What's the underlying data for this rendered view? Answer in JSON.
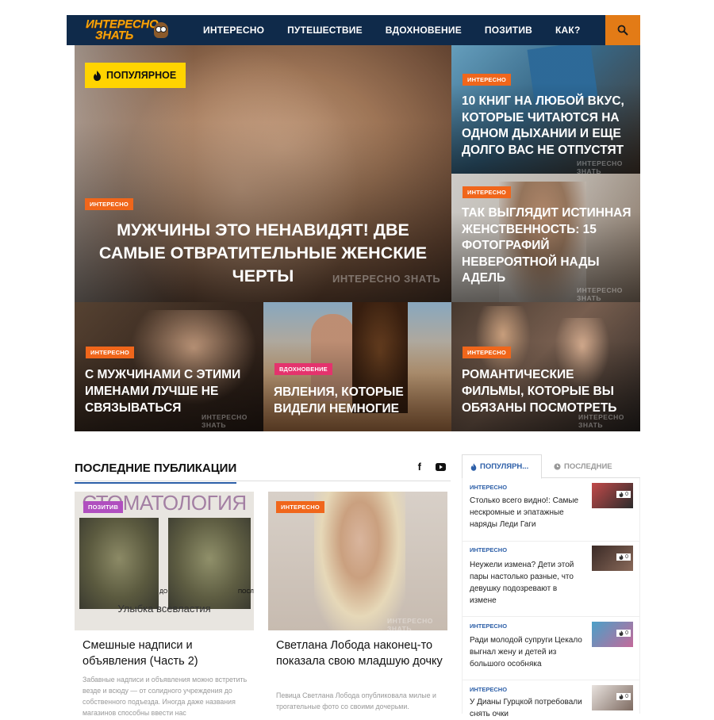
{
  "header": {
    "logo_line1": "ИНТЕРЕСНО",
    "logo_line2": "ЗНАТЬ",
    "nav": [
      "ИНТЕРЕСНО",
      "ПУТЕШЕСТВИЕ",
      "ВДОХНОВЕНИЕ",
      "ПОЗИТИВ",
      "КАК?"
    ],
    "search_icon": "search-icon"
  },
  "hero": {
    "popular_label": "ПОПУЛЯРНОЕ",
    "main": {
      "category": "ИНТЕРЕСНО",
      "title": "МУЖЧИНЫ ЭТО НЕНАВИДЯТ! ДВЕ САМЫЕ ОТВРАТИТЕЛЬНЫЕ ЖЕНСКИЕ ЧЕРТЫ"
    },
    "right_top": {
      "category": "ИНТЕРЕСНО",
      "title": "10 КНИГ НА ЛЮБОЙ ВКУС, КОТОРЫЕ ЧИТАЮТСЯ НА ОДНОМ ДЫХАНИИ И ЕЩЕ ДОЛГО ВАС НЕ ОТПУСТЯТ"
    },
    "right_mid": {
      "category": "ИНТЕРЕСНО",
      "title": "ТАК ВЫГЛЯДИТ ИСТИННАЯ ЖЕНСТВЕННОСТЬ: 15 ФОТОГРАФИЙ НЕВЕРОЯТНОЙ НАДЫ АДЕЛЬ"
    },
    "bottom_left": {
      "category": "ИНТЕРЕСНО",
      "title": "С МУЖЧИНАМИ С ЭТИМИ ИМЕНАМИ ЛУЧШЕ НЕ СВЯЗЫВАТЬСЯ"
    },
    "bottom_mid": {
      "category": "ВДОХНОВЕНИЕ",
      "title": "ЯВЛЕНИЯ, КОТОРЫЕ ВИДЕЛИ НЕМНОГИЕ"
    },
    "bottom_right": {
      "category": "ИНТЕРЕСНО",
      "title": "РОМАНТИЧЕСКИЕ ФИЛЬМЫ, КОТОРЫЕ ВЫ ОБЯЗАНЫ ПОСМОТРЕТЬ"
    },
    "watermark": "ИНТЕРЕСНО ЗНАТЬ"
  },
  "latest": {
    "section_title": "ПОСЛЕДНИЕ ПУБЛИКАЦИИ",
    "social_facebook": "f",
    "cards": [
      {
        "category": "ПОЗИТИВ",
        "image_heading": "СТОМАТОЛОГИЯ",
        "image_caption": "Улыбка всевластия",
        "label_before": "ДО",
        "label_after": "ПОСЛ",
        "title": "Смешные надписи и объявления (Часть 2)",
        "excerpt": "Забавные надписи и объявления можно встретить везде и всюду — от солидного учреждения до собственного подъезда. Иногда даже названия магазинов способны ввести нас"
      },
      {
        "category": "ИНТЕРЕСНО",
        "title": "Светлана Лобода наконец-то показала свою младшую дочку",
        "excerpt": "Певица Светлана Лобода опубликовала милые и трогательные фото со своими дочерьми."
      }
    ]
  },
  "sidebar": {
    "tab_popular": "ПОПУЛЯРН...",
    "tab_latest": "ПОСЛЕДНИЕ",
    "items": [
      {
        "category": "ИНТЕРЕСНО",
        "title": "Столько всего видно!: Самые нескромные и эпатажные наряды Леди Гаги",
        "count": "0"
      },
      {
        "category": "ИНТЕРЕСНО",
        "title": "Неужели измена? Дети этой пары настолько разные, что девушку подозревают в измене",
        "count": "0"
      },
      {
        "category": "ИНТЕРЕСНО",
        "title": "Ради молодой супруги Цекало выгнал жену и детей из большого особняка",
        "count": "0"
      },
      {
        "category": "ИНТЕРЕСНО",
        "title": "У Дианы Гурцкой потребовали снять очки",
        "count": "0"
      }
    ]
  },
  "colors": {
    "header_bg": "#0f2a4a",
    "accent_orange": "#e37b16",
    "badge_orange": "#f0661b",
    "badge_pink": "#e4336d",
    "badge_violet": "#b04fbf",
    "popular_yellow": "#ffd400",
    "link_blue": "#2d5fa8"
  }
}
